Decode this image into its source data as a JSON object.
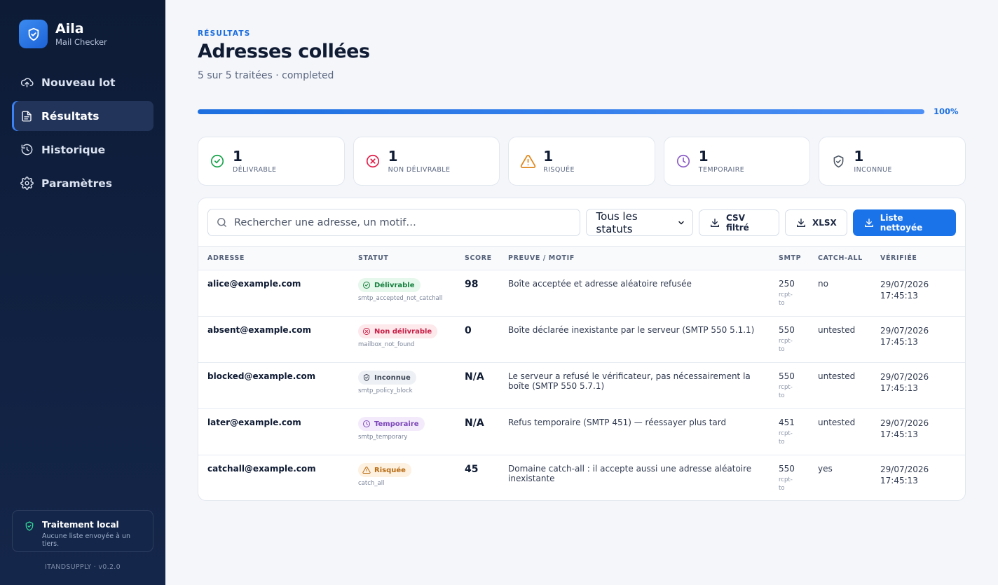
{
  "brand": {
    "name": "Aila",
    "subtitle": "Mail Checker"
  },
  "nav": [
    {
      "label": "Nouveau lot",
      "icon": "upload-cloud-icon"
    },
    {
      "label": "Résultats",
      "icon": "document-icon",
      "active": true
    },
    {
      "label": "Historique",
      "icon": "history-icon"
    },
    {
      "label": "Paramètres",
      "icon": "gear-icon"
    }
  ],
  "local": {
    "title": "Traitement local",
    "subtitle": "Aucune liste envoyée à un tiers."
  },
  "version": "ITANDSUPPLY · v0.2.0",
  "header": {
    "eyebrow": "RÉSULTATS",
    "title": "Adresses collées",
    "subtitle": "5 sur 5 traitées · completed"
  },
  "progress": {
    "value": 1.0,
    "label": "100%"
  },
  "stats": [
    {
      "count": "1",
      "label": "DÉLIVRABLE",
      "icon": "check-circle-icon",
      "color": "#16a34a"
    },
    {
      "count": "1",
      "label": "NON DÉLIVRABLE",
      "icon": "x-circle-icon",
      "color": "#e11d48"
    },
    {
      "count": "1",
      "label": "RISQUÉE",
      "icon": "warning-triangle-icon",
      "color": "#e0861a"
    },
    {
      "count": "1",
      "label": "TEMPORAIRE",
      "icon": "clock-icon",
      "color": "#8b5cc7"
    },
    {
      "count": "1",
      "label": "INCONNUE",
      "icon": "shield-check-icon",
      "color": "#4b5563"
    }
  ],
  "toolbar": {
    "search_placeholder": "Rechercher une adresse, un motif…",
    "status_filter": "Tous les statuts",
    "csv_label": "CSV filtré",
    "xlsx_label": "XLSX",
    "clean_label": "Liste nettoyée"
  },
  "table": {
    "headers": [
      "ADRESSE",
      "STATUT",
      "SCORE",
      "PREUVE / MOTIF",
      "SMTP",
      "CATCH-ALL",
      "VÉRIFIÉE"
    ],
    "rows": [
      {
        "address": "alice@example.com",
        "status": "Délivrable",
        "status_kind": "ok",
        "reason": "smtp_accepted_not_catchall",
        "score": "98",
        "proof": "Boîte acceptée et adresse aléatoire refusée",
        "smtp": "250",
        "smtp_sub": "rcpt-to",
        "catch_all": "no",
        "date": "29/07/2026",
        "time": "17:45:13"
      },
      {
        "address": "absent@example.com",
        "status": "Non délivrable",
        "status_kind": "bad",
        "reason": "mailbox_not_found",
        "score": "0",
        "proof": "Boîte déclarée inexistante par le serveur (SMTP 550 5.1.1)",
        "smtp": "550",
        "smtp_sub": "rcpt-to",
        "catch_all": "untested",
        "date": "29/07/2026",
        "time": "17:45:13"
      },
      {
        "address": "blocked@example.com",
        "status": "Inconnue",
        "status_kind": "unknown",
        "reason": "smtp_policy_block",
        "score": "N/A",
        "proof": "Le serveur a refusé le vérificateur, pas nécessairement la boîte (SMTP 550 5.7.1)",
        "smtp": "550",
        "smtp_sub": "rcpt-to",
        "catch_all": "untested",
        "date": "29/07/2026",
        "time": "17:45:13"
      },
      {
        "address": "later@example.com",
        "status": "Temporaire",
        "status_kind": "temp",
        "reason": "smtp_temporary",
        "score": "N/A",
        "proof": "Refus temporaire (SMTP 451) — réessayer plus tard",
        "smtp": "451",
        "smtp_sub": "rcpt-to",
        "catch_all": "untested",
        "date": "29/07/2026",
        "time": "17:45:13"
      },
      {
        "address": "catchall@example.com",
        "status": "Risquée",
        "status_kind": "risk",
        "reason": "catch_all",
        "score": "45",
        "proof": "Domaine catch-all : il accepte aussi une adresse aléatoire inexistante",
        "smtp": "550",
        "smtp_sub": "rcpt-to",
        "catch_all": "yes",
        "date": "29/07/2026",
        "time": "17:45:13"
      }
    ]
  },
  "colors": {
    "accent": "#1a73e8",
    "ok": "#16a34a",
    "bad": "#e11d48",
    "risk": "#e0861a",
    "temp": "#8b5cc7",
    "unknown": "#4b5563"
  }
}
